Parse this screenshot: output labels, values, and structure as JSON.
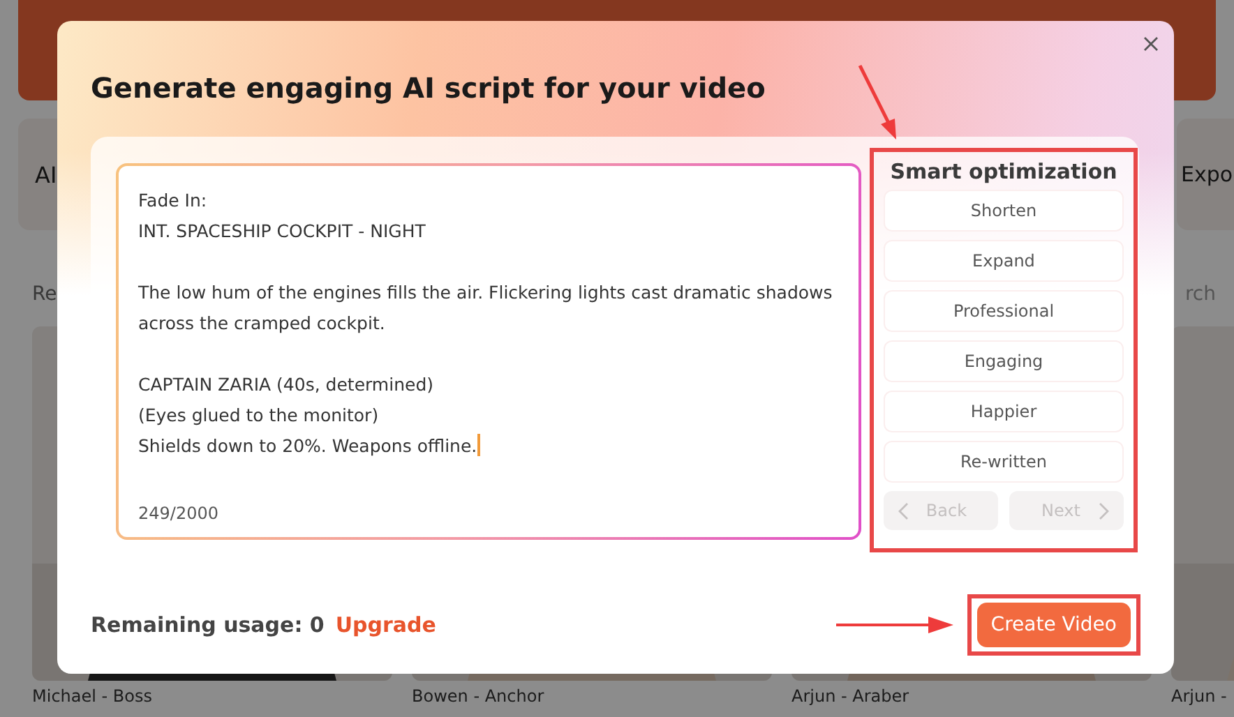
{
  "background": {
    "tabs": [
      {
        "label": "AI"
      },
      {
        "label": "Expo"
      }
    ],
    "section_label": "Re",
    "search": {
      "placeholder": "rch"
    },
    "cards": [
      {
        "name": "Michael - Boss"
      },
      {
        "name": "Bowen - Anchor"
      },
      {
        "name": "Arjun - Araber"
      },
      {
        "name": "Arjun -"
      }
    ]
  },
  "dialog": {
    "title": "Generate engaging AI script for your video",
    "script": {
      "paragraphs": [
        [
          "Fade In:",
          "INT. SPACESHIP COCKPIT - NIGHT"
        ],
        [
          "The low hum of the engines fills the air. Flickering lights cast dramatic shadows across the cramped cockpit."
        ],
        [
          "CAPTAIN ZARIA (40s, determined)",
          "(Eyes glued to the monitor)",
          "Shields down to 20%. Weapons offline."
        ]
      ],
      "counter": "249/2000"
    },
    "optimization": {
      "title": "Smart optimization",
      "options": [
        "Shorten",
        "Expand",
        "Professional",
        "Engaging",
        "Happier",
        "Re-written"
      ],
      "back": {
        "label": "Back",
        "disabled": true
      },
      "next": {
        "label": "Next",
        "disabled": true
      }
    },
    "usage": {
      "label": "Remaining usage: 0",
      "upgrade": "Upgrade"
    },
    "create_button": "Create Video"
  }
}
